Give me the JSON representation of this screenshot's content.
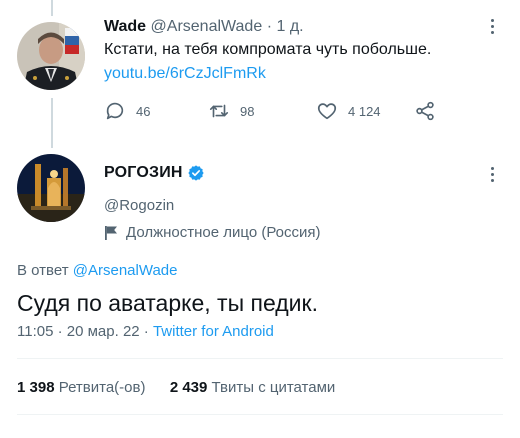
{
  "tweet1": {
    "name": "Wade",
    "handle": "@ArsenalWade",
    "separator": "·",
    "time": "1 д.",
    "text": "Кстати, на тебя компромата чуть побольше.",
    "link": "youtu.be/6rCzJclFmRk",
    "counts": {
      "replies": "46",
      "retweets": "98",
      "likes": "4 124"
    }
  },
  "tweet2": {
    "name": "РОГОЗИН",
    "handle": "@Rogozin",
    "account_label": "Должностное лицо (Россия)",
    "reply_prefix": "В ответ",
    "reply_mention": "@ArsenalWade",
    "text": "Судя по аватарке, ты педик.",
    "timestamp": "11:05 · 20 мар. 22 ·",
    "source": "Twitter for Android",
    "stats": {
      "retweets_count": "1 398",
      "retweets_label": "Ретвита(-ов)",
      "quotes_count": "2 439",
      "quotes_label": "Твиты с цитатами"
    }
  },
  "icons": {
    "more": "more-icon",
    "reply": "reply-icon",
    "retweet": "retweet-icon",
    "like": "heart-icon",
    "share": "share-icon",
    "verified": "verified-badge-icon",
    "flag": "flag-icon"
  },
  "colors": {
    "text": "#0f1419",
    "secondary": "#536471",
    "accent": "#1d9bf0",
    "divider": "#eff3f4",
    "thread_line": "#cfd9de"
  }
}
